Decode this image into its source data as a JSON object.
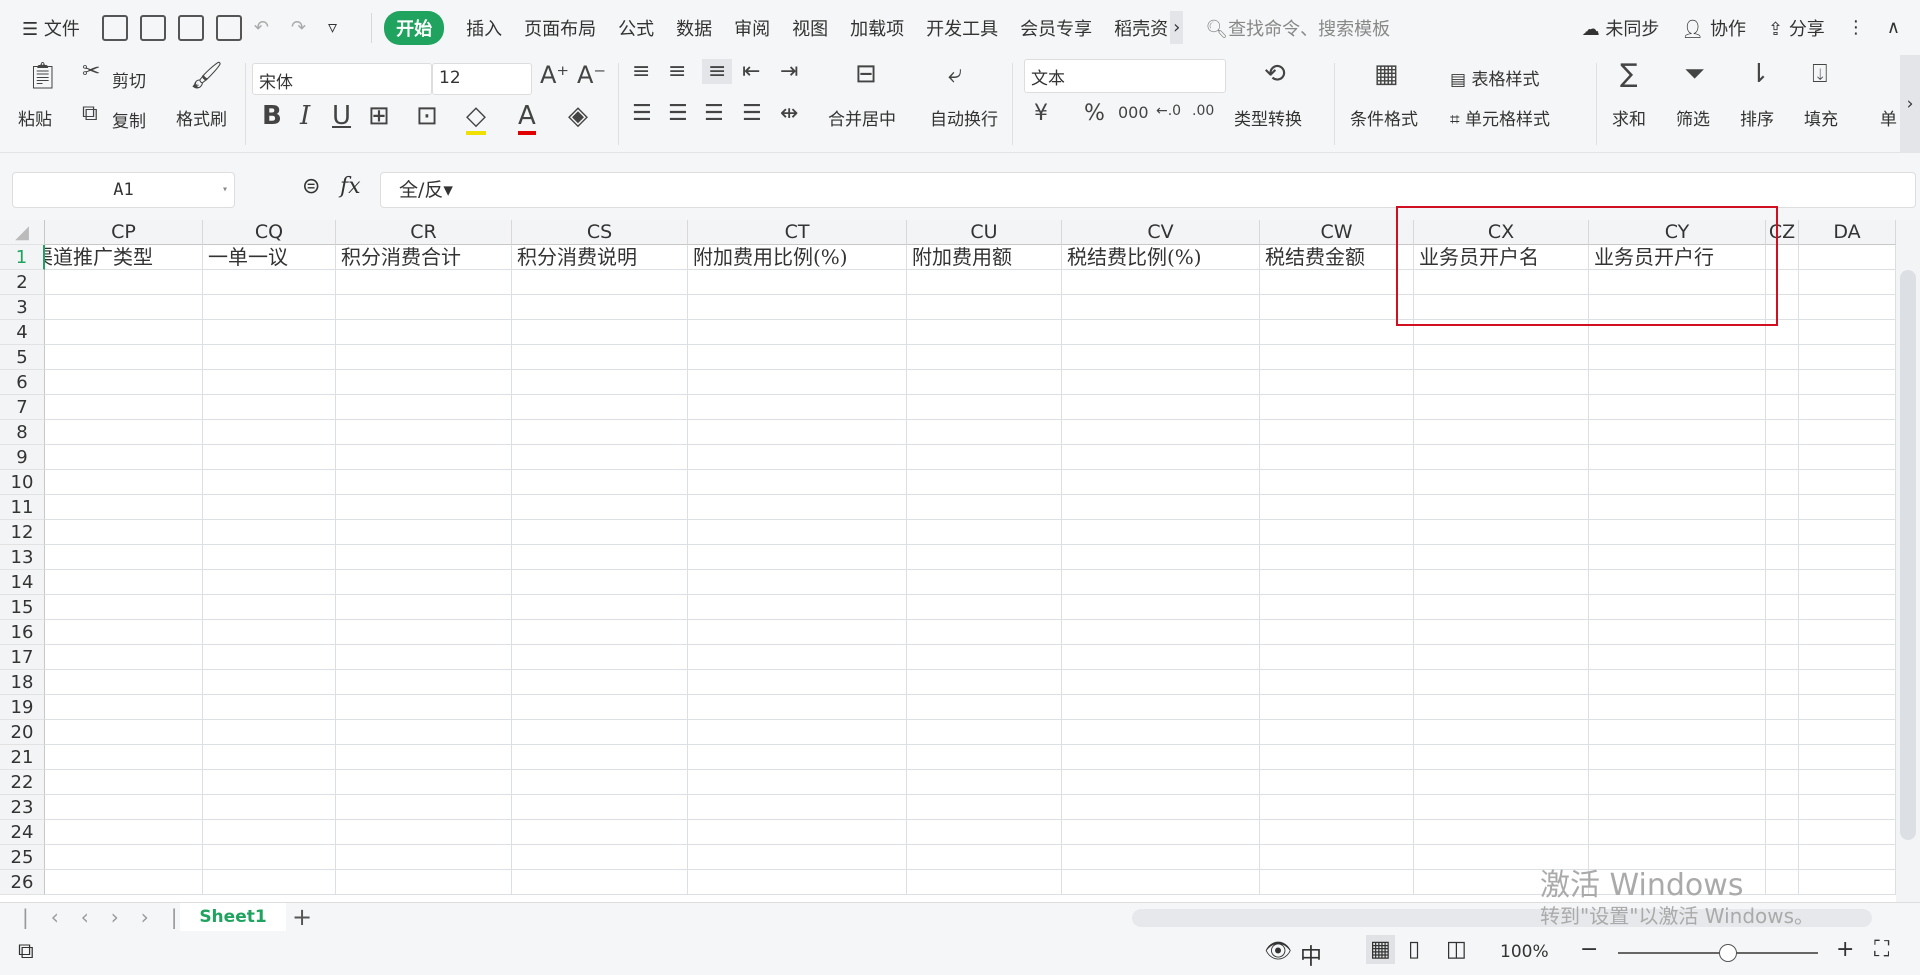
{
  "menubar": {
    "file": "文件",
    "tabs": [
      "开始",
      "插入",
      "页面布局",
      "公式",
      "数据",
      "审阅",
      "视图",
      "加载项",
      "开发工具",
      "会员专享",
      "稻壳资"
    ],
    "search_placeholder": "查找命令、搜索模板",
    "sync": "未同步",
    "collab": "协作",
    "share": "分享"
  },
  "ribbon": {
    "paste": "粘贴",
    "cut": "剪切",
    "copy": "复制",
    "format_painter": "格式刷",
    "font": "宋体",
    "font_size": "12",
    "merge": "合并居中",
    "wrap": "自动换行",
    "number_format": "文本",
    "type_convert": "类型转换",
    "cond_format": "条件格式",
    "table_style": "表格样式",
    "cell_style": "单元格样式",
    "sum": "求和",
    "filter": "筛选",
    "sort": "排序",
    "fill": "填充",
    "more": "单"
  },
  "formula_bar": {
    "cell_ref": "A1",
    "fx": "fx",
    "value": "全/反▾"
  },
  "columns": [
    "CP",
    "CQ",
    "CR",
    "CS",
    "CT",
    "CU",
    "CV",
    "CW",
    "CX",
    "CY",
    "CZ",
    "DA"
  ],
  "row1": [
    "渠道推广类型",
    "一单一议",
    "积分消费合计",
    "积分消费说明",
    "附加费用比例(%)",
    "附加费用额",
    "税结费比例(%)",
    "税结费金额",
    "业务员开户名",
    "业务员开户行",
    "",
    ""
  ],
  "row_count": 26,
  "sheets": {
    "active": "Sheet1"
  },
  "status": {
    "zoom": "100%",
    "zoom_fraction": 0.55
  },
  "watermark": {
    "line1": "激活 Windows",
    "line2": "转到\"设置\"以激活 Windows。"
  },
  "colors": {
    "accent": "#1fa35f",
    "highlight": "#d01020"
  }
}
